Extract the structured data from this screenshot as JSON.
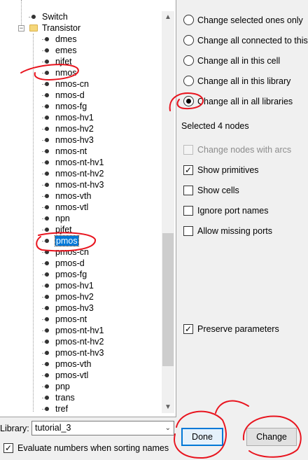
{
  "tree": {
    "top_items": [
      {
        "label": "Switch"
      },
      {
        "label": "Transistor"
      }
    ],
    "children": [
      {
        "label": "dmes"
      },
      {
        "label": "emes"
      },
      {
        "label": "njfet"
      },
      {
        "label": "nmos"
      },
      {
        "label": "nmos-cn"
      },
      {
        "label": "nmos-d"
      },
      {
        "label": "nmos-fg"
      },
      {
        "label": "nmos-hv1"
      },
      {
        "label": "nmos-hv2"
      },
      {
        "label": "nmos-hv3"
      },
      {
        "label": "nmos-nt"
      },
      {
        "label": "nmos-nt-hv1"
      },
      {
        "label": "nmos-nt-hv2"
      },
      {
        "label": "nmos-nt-hv3"
      },
      {
        "label": "nmos-vth"
      },
      {
        "label": "nmos-vtl"
      },
      {
        "label": "npn"
      },
      {
        "label": "pjfet"
      },
      {
        "label": "pmos"
      },
      {
        "label": "pmos-cn"
      },
      {
        "label": "pmos-d"
      },
      {
        "label": "pmos-fg"
      },
      {
        "label": "pmos-hv1"
      },
      {
        "label": "pmos-hv2"
      },
      {
        "label": "pmos-hv3"
      },
      {
        "label": "pmos-nt"
      },
      {
        "label": "pmos-nt-hv1"
      },
      {
        "label": "pmos-nt-hv2"
      },
      {
        "label": "pmos-nt-hv3"
      },
      {
        "label": "pmos-vth"
      },
      {
        "label": "pmos-vtl"
      },
      {
        "label": "pnp"
      },
      {
        "label": "trans"
      },
      {
        "label": "tref"
      }
    ],
    "selected": "pmos"
  },
  "scope_options": [
    {
      "label": "Change selected ones only",
      "checked": false
    },
    {
      "label": "Change all connected to this",
      "checked": false
    },
    {
      "label": "Change all in this cell",
      "checked": false
    },
    {
      "label": "Change all in this library",
      "checked": false
    },
    {
      "label": "Change all in all libraries",
      "checked": true
    }
  ],
  "status": {
    "selected_nodes": "Selected 4 nodes"
  },
  "checkboxes": [
    {
      "label": "Change nodes with arcs",
      "checked": false,
      "disabled": true
    },
    {
      "label": "Show primitives",
      "checked": true,
      "disabled": false
    },
    {
      "label": "Show cells",
      "checked": false,
      "disabled": false
    },
    {
      "label": "Ignore port names",
      "checked": false,
      "disabled": false
    },
    {
      "label": "Allow missing ports",
      "checked": false,
      "disabled": false
    }
  ],
  "preserve": {
    "label": "Preserve parameters",
    "checked": true
  },
  "library": {
    "label": "Library:",
    "value": "tutorial_3"
  },
  "evaluate": {
    "label": "Evaluate numbers when sorting names",
    "checked": true
  },
  "buttons": {
    "done": "Done",
    "change": "Change"
  },
  "colors": {
    "selection": "#0078d7",
    "annotation": "#e8141e",
    "folder": "#f5d77a"
  }
}
